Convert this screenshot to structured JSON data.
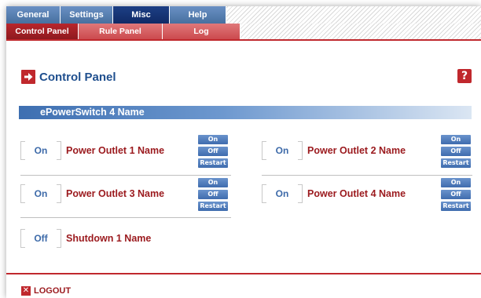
{
  "top_tabs": [
    {
      "label": "General",
      "active": false
    },
    {
      "label": "Settings",
      "active": false
    },
    {
      "label": "Misc",
      "active": true
    },
    {
      "label": "Help",
      "active": false
    }
  ],
  "sub_tabs": [
    {
      "label": "Control Panel",
      "active": true
    },
    {
      "label": "Rule Panel",
      "active": false
    },
    {
      "label": "Log",
      "active": false
    }
  ],
  "page": {
    "title": "Control Panel",
    "help_glyph": "?",
    "arrow_icon": "arrow-right-icon"
  },
  "device": {
    "name": "ePowerSwitch 4 Name"
  },
  "buttons": {
    "on": "On",
    "off": "Off",
    "restart": "Restart"
  },
  "outlets": [
    {
      "status": "On",
      "name": "Power Outlet 1 Name"
    },
    {
      "status": "On",
      "name": "Power Outlet 2 Name"
    },
    {
      "status": "On",
      "name": "Power Outlet 3 Name"
    },
    {
      "status": "On",
      "name": "Power Outlet 4 Name"
    }
  ],
  "shutdowns": [
    {
      "status": "Off",
      "name": "Shutdown 1 Name"
    }
  ],
  "footer": {
    "logout_label": "LOGOUT",
    "logout_glyph": "✕"
  },
  "colors": {
    "brand_blue": "#1f4f8e",
    "brand_red": "#c0282d",
    "accent_blue": "#3f6cae"
  }
}
